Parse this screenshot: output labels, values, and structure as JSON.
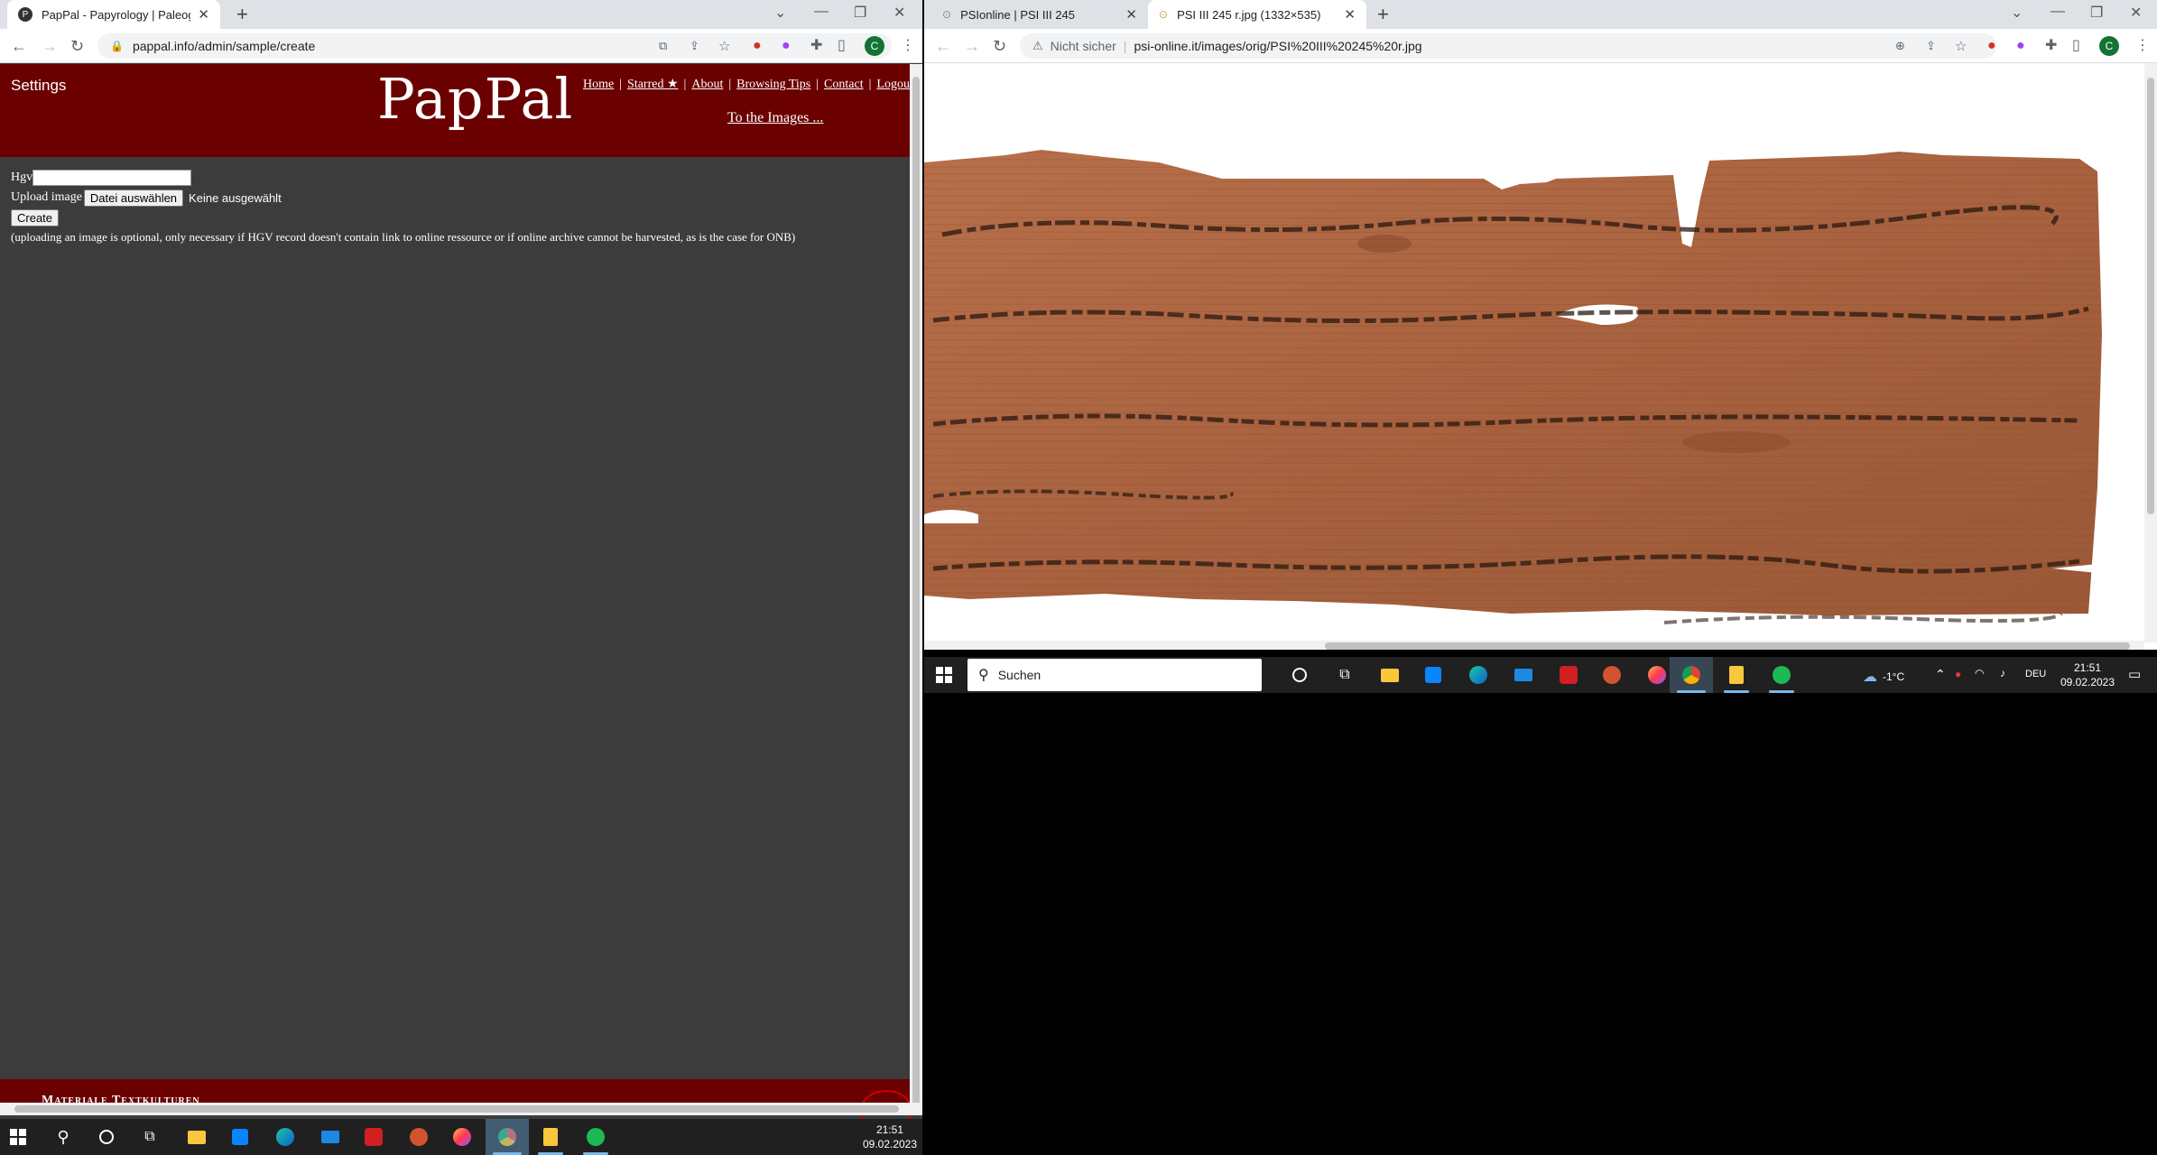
{
  "left_browser": {
    "tabs": [
      {
        "title": "PapPal - Papyrology | Paleography",
        "favicon": "P"
      }
    ],
    "url": "pappal.info/admin/sample/create",
    "profile_initial": "C"
  },
  "pappal": {
    "settings_label": "Settings",
    "logo": "PapPal",
    "nav": [
      "Home",
      "Starred ★",
      "About",
      "Browsing Tips",
      "Contact",
      "Logout"
    ],
    "to_images": "To the Images ...",
    "hgv_label": "Hgv",
    "hgv_value": "",
    "upload_label": "Upload image",
    "choose_file_button": "Datei auswählen",
    "no_file_text": "Keine ausgewählt",
    "create_button": "Create",
    "note": "(uploading an image is optional, only necessary if HGV record doesn't contain link to online ressource or if online archive cannot be harvested, as is the case for ONB)",
    "footer_text": "Materiale Textkulturen",
    "header_color": "#6b0000",
    "body_color": "#3c3c3c"
  },
  "right_browser": {
    "tabs": [
      {
        "title": "PSIonline | PSI III 245",
        "active": false
      },
      {
        "title": "PSI III 245 r.jpg (1332×535)",
        "active": true
      }
    ],
    "security": "Nicht sicher",
    "url": "psi-online.it/images/orig/PSI%20III%20245%20r.jpg",
    "profile_initial": "C"
  },
  "right_taskbar": {
    "search_placeholder": "Suchen",
    "weather": "-1°C",
    "language": "DEU",
    "time": "21:51",
    "date": "09.02.2023"
  },
  "left_taskbar": {
    "time": "21:51",
    "date": "09.02.2023"
  }
}
